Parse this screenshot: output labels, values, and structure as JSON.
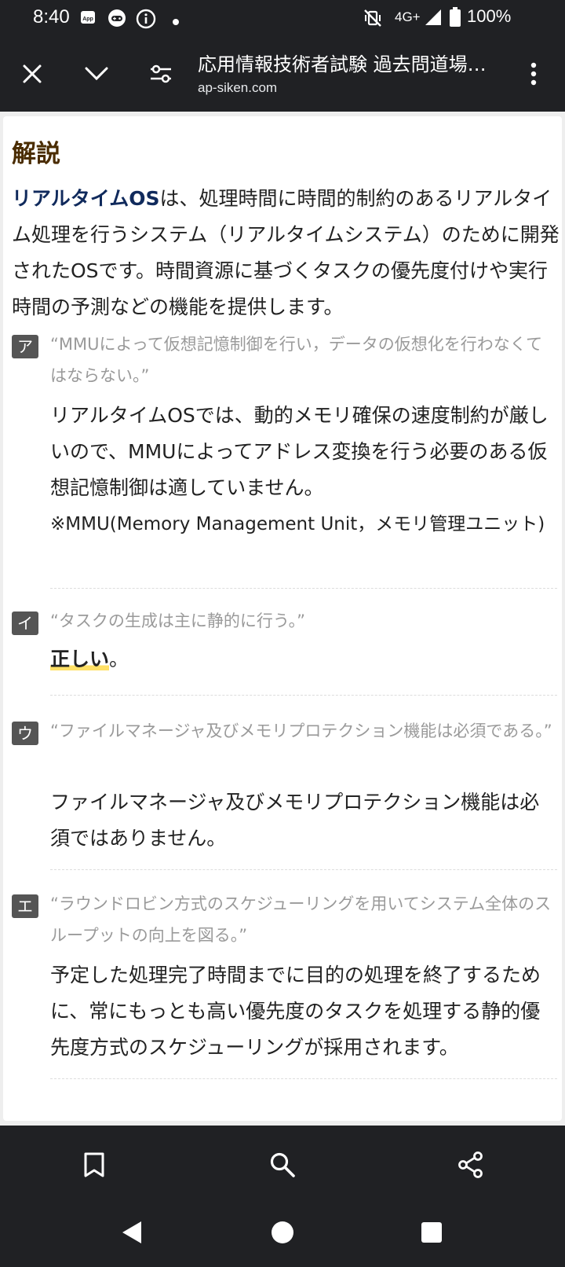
{
  "status_bar": {
    "time": "8:40",
    "network": "4G+",
    "battery": "100%"
  },
  "url_bar": {
    "title": "応用情報技術者試験 過去問道場…",
    "host": "ap-siken.com"
  },
  "content": {
    "heading": "解説",
    "intro_term": "リアルタイムOS",
    "intro_rest": "は、処理時間に時間的制約のあるリアルタイム処理を行うシステム（リアルタイムシステム）のために開発されたOSです。時間資源に基づくタスクの優先度付けや実行時間の予測などの機能を提供します。",
    "options": [
      {
        "letter": "ア",
        "quote": "“MMUによって仮想記憶制御を行い，データの仮想化を行わなくてはならない。”",
        "explanation": "リアルタイムOSでは、動的メモリ確保の速度制約が厳しいので、MMUによってアドレス変換を行う必要のある仮想記憶制御は適していません。",
        "note": "※MMU(Memory Management Unit，メモリ管理ユニット)"
      },
      {
        "letter": "イ",
        "quote": "“タスクの生成は主に静的に行う。”",
        "explanation_highlight": "正しい",
        "explanation_suffix": "。"
      },
      {
        "letter": "ウ",
        "quote": "“ファイルマネージャ及びメモリプロテクション機能は必須である。”",
        "explanation": "ファイルマネージャ及びメモリプロテクション機能は必須ではありません。"
      },
      {
        "letter": "エ",
        "quote": "“ラウンドロビン方式のスケジューリングを用いてシステム全体のスループットの向上を図る。”",
        "explanation": "予定した処理完了時間までに目的の処理を終了するために、常にもっとも高い優先度のタスクを処理する静的優先度方式のスケジューリングが採用されます。"
      }
    ]
  },
  "icons": {
    "close": "close-icon",
    "collapse": "chevron-down-icon",
    "site_settings": "tune-icon",
    "menu": "more-vert-icon",
    "bookmark": "bookmark-icon",
    "search": "search-icon",
    "share": "share-icon",
    "back": "back-triangle-icon",
    "home": "home-circle-icon",
    "recents": "recents-square-icon"
  },
  "colors": {
    "chrome": "#202124",
    "heading": "#4a2c00",
    "term": "#102a5c",
    "highlight": "#ffe066",
    "letter_badge": "#555555"
  }
}
